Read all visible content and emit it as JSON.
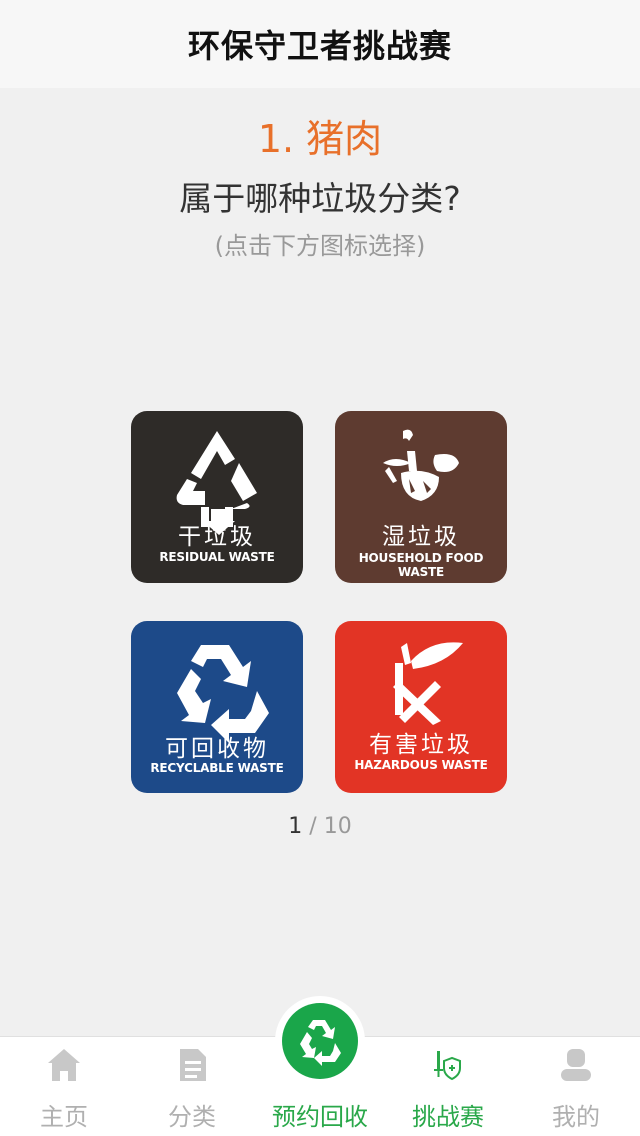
{
  "header": {
    "title": "环保守卫者挑战赛"
  },
  "question": {
    "number_label": "1. 猪肉",
    "text": "属于哪种垃圾分类?",
    "hint": "(点击下方图标选择)"
  },
  "bins": [
    {
      "name_cn": "干垃圾",
      "name_en": "RESIDUAL WASTE",
      "color": "#2e2b28",
      "icon": "residual-waste-icon"
    },
    {
      "name_cn": "湿垃圾",
      "name_en": "HOUSEHOLD FOOD WASTE",
      "color": "#5e3b30",
      "icon": "food-waste-icon"
    },
    {
      "name_cn": "可回收物",
      "name_en": "RECYCLABLE WASTE",
      "color": "#1d4a89",
      "icon": "recycle-icon"
    },
    {
      "name_cn": "有害垃圾",
      "name_en": "HAZARDOUS WASTE",
      "color": "#e23425",
      "icon": "hazardous-waste-icon"
    }
  ],
  "pager": {
    "current": "1",
    "separator": " / ",
    "total": "10"
  },
  "tabbar": {
    "accent_color": "#2aa84a",
    "inactive_color": "#b0b0b0",
    "tabs": [
      {
        "label": "主页",
        "icon": "home-icon",
        "active": false
      },
      {
        "label": "分类",
        "icon": "document-icon",
        "active": false
      },
      {
        "label": "预约回收",
        "icon": "recycle-icon",
        "active": true
      },
      {
        "label": "挑战赛",
        "icon": "sword-shield-icon",
        "active": true
      },
      {
        "label": "我的",
        "icon": "user-icon",
        "active": false
      }
    ]
  }
}
